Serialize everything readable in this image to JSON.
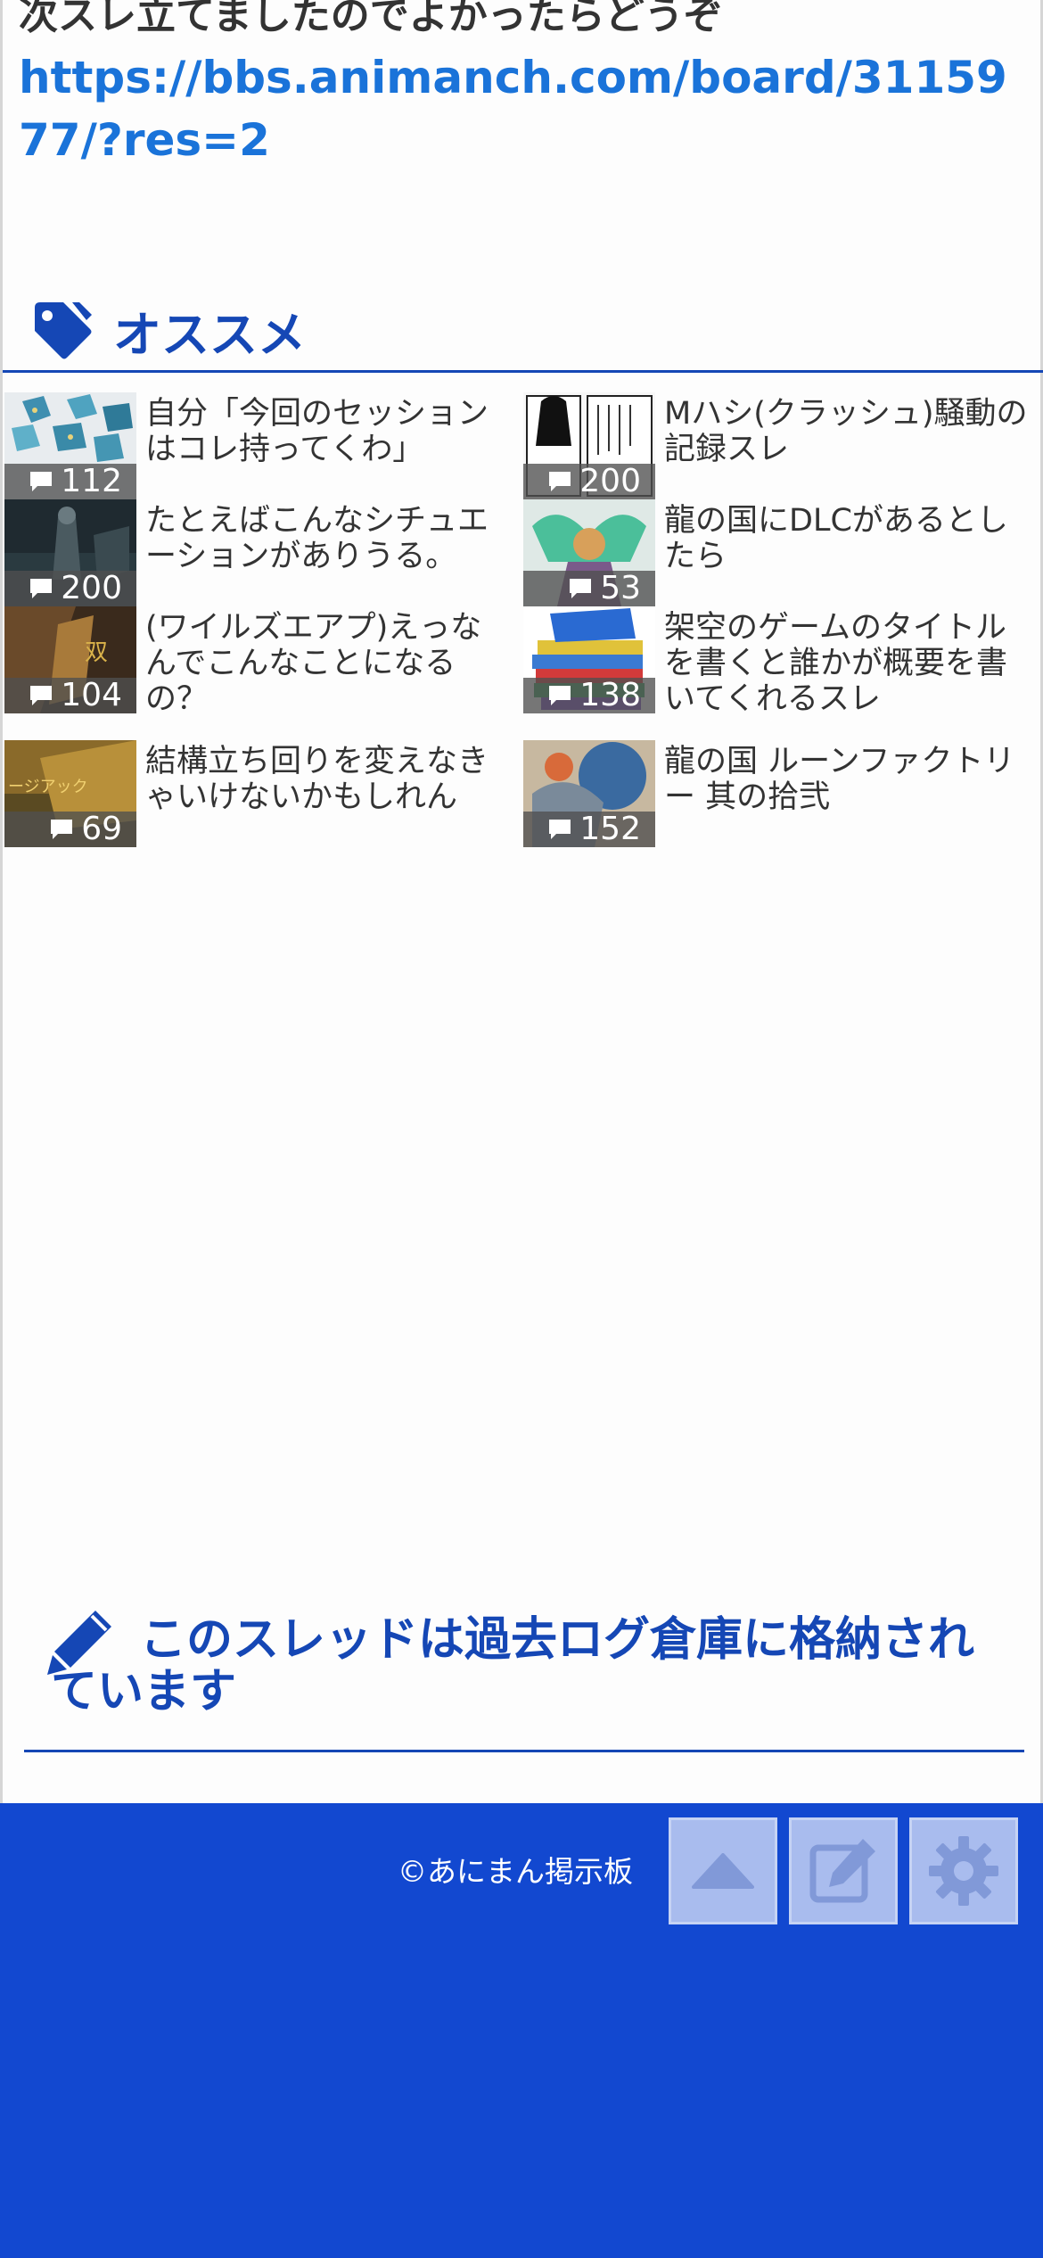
{
  "post": {
    "text": "次スレ立てましたのでよかったらどうぞ",
    "link": "https://bbs.animanch.com/board/3115977/?res=2"
  },
  "recommend": {
    "title": "オススメ",
    "icon": "tag-icon",
    "items": [
      {
        "title": "自分「今回のセッションはコレ持ってくわ」",
        "count": "112"
      },
      {
        "title": "Mハシ(クラッシュ)騒動の記録スレ",
        "count": "200"
      },
      {
        "title": "たとえばこんなシチュエーションがありうる。",
        "count": "200"
      },
      {
        "title": "龍の国にDLCがあるとしたら",
        "count": "53"
      },
      {
        "title": "(ワイルズエアプ)えっなんでこんなことになるの？",
        "count": "104"
      },
      {
        "title": "架空のゲームのタイトルを書くと誰かが概要を書いてくれるスレ",
        "count": "138"
      },
      {
        "title": "結構立ち回りを変えなきゃいけないかもしれん",
        "count": "69"
      },
      {
        "title": "龍の国 ルーンファクトリー 其の拾弐",
        "count": "152"
      }
    ]
  },
  "archive": {
    "text": "このスレッドは過去ログ倉庫に格納されています",
    "icon": "pencil-icon"
  },
  "footer": {
    "copyright": "©あにまん掲示板",
    "buttons": [
      "scroll-top",
      "compose",
      "settings"
    ]
  },
  "colors": {
    "accent": "#1547b5",
    "link": "#1a73d9",
    "footer_bg": "#1248d0",
    "footer_button": "#a9bcee"
  }
}
